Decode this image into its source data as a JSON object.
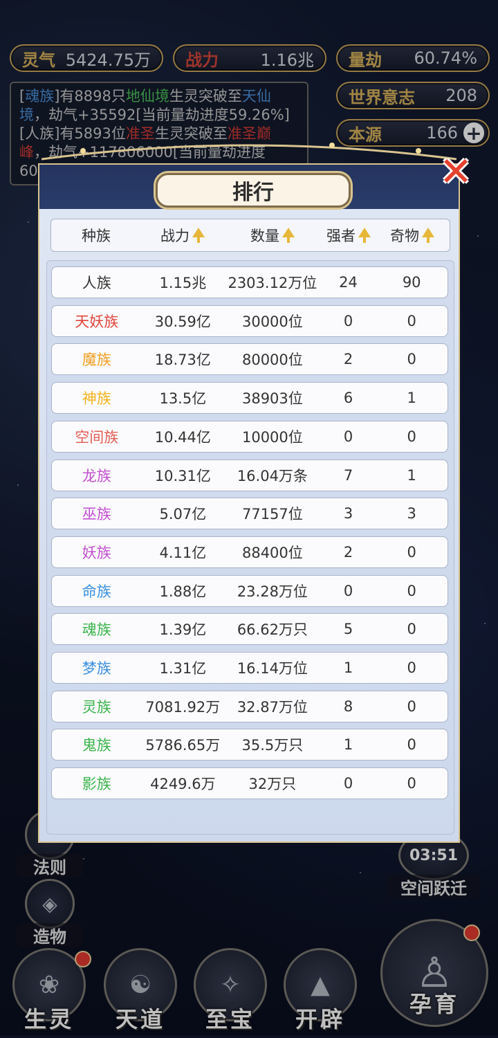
{
  "stats": {
    "lingqi": {
      "label": "灵气",
      "value": "5424.75万"
    },
    "zhanli": {
      "label": "战力",
      "value": "1.16兆"
    },
    "liangjie": {
      "label": "量劫",
      "value": "60.74%"
    },
    "shijie": {
      "label": "世界意志",
      "value": "208"
    },
    "benyuan": {
      "label": "本源",
      "value": "166",
      "plus": "+"
    }
  },
  "log": {
    "line1_a": "[",
    "line1_race": "魂族",
    "line1_b": "]有8898只",
    "line1_realm": "地仙境",
    "line1_c": "生灵突破至",
    "line1_target": "天仙境",
    "line1_d": "，劫气+35592[当前量劫进度59.26%]",
    "line2_a": "[人族]有5893位",
    "line2_realm": "准圣",
    "line2_c": "生灵突破至",
    "line2_target": "准圣巅峰",
    "line2_d": "，劫气+117806000[当前量劫进度",
    "line3": "60"
  },
  "modal": {
    "title": "排行",
    "close": "✕",
    "headers": [
      "种族",
      "战力",
      "数量",
      "强者",
      "奇物"
    ],
    "rows": [
      {
        "race": "人族",
        "color": "#333333",
        "power": "1.15兆",
        "count": "2303.12万位",
        "strong": "24",
        "items": "90"
      },
      {
        "race": "天妖族",
        "color": "#e1443b",
        "power": "30.59亿",
        "count": "30000位",
        "strong": "0",
        "items": "0"
      },
      {
        "race": "魔族",
        "color": "#f29d1f",
        "power": "18.73亿",
        "count": "80000位",
        "strong": "2",
        "items": "0"
      },
      {
        "race": "神族",
        "color": "#f2b21b",
        "power": "13.5亿",
        "count": "38903位",
        "strong": "6",
        "items": "1"
      },
      {
        "race": "空间族",
        "color": "#e25c52",
        "power": "10.44亿",
        "count": "10000位",
        "strong": "0",
        "items": "0"
      },
      {
        "race": "龙族",
        "color": "#c24fd0",
        "power": "10.31亿",
        "count": "16.04万条",
        "strong": "7",
        "items": "1"
      },
      {
        "race": "巫族",
        "color": "#c24fd0",
        "power": "5.07亿",
        "count": "77157位",
        "strong": "3",
        "items": "3"
      },
      {
        "race": "妖族",
        "color": "#c24fd0",
        "power": "4.11亿",
        "count": "88400位",
        "strong": "2",
        "items": "0"
      },
      {
        "race": "命族",
        "color": "#3a8fe0",
        "power": "1.88亿",
        "count": "23.28万位",
        "strong": "0",
        "items": "0"
      },
      {
        "race": "魂族",
        "color": "#3ab34a",
        "power": "1.39亿",
        "count": "66.62万只",
        "strong": "5",
        "items": "0"
      },
      {
        "race": "梦族",
        "color": "#3a8fe0",
        "power": "1.31亿",
        "count": "16.14万位",
        "strong": "1",
        "items": "0"
      },
      {
        "race": "灵族",
        "color": "#3ab34a",
        "power": "7081.92万",
        "count": "32.87万位",
        "strong": "8",
        "items": "0"
      },
      {
        "race": "鬼族",
        "color": "#3ab34a",
        "power": "5786.65万",
        "count": "35.5万只",
        "strong": "1",
        "items": "0"
      },
      {
        "race": "影族",
        "color": "#3ab34a",
        "power": "4249.6万",
        "count": "32万只",
        "strong": "0",
        "items": "0"
      }
    ]
  },
  "side": {
    "fa_ze": "法则",
    "zao_wu": "造物",
    "timer": "03:51",
    "kongjian": "空间跃迁"
  },
  "nav": {
    "sheng_ling": "生灵",
    "tian_dao": "天道",
    "zhi_bao": "至宝",
    "kai_pi": "开辟",
    "yun_yu": "孕育"
  }
}
